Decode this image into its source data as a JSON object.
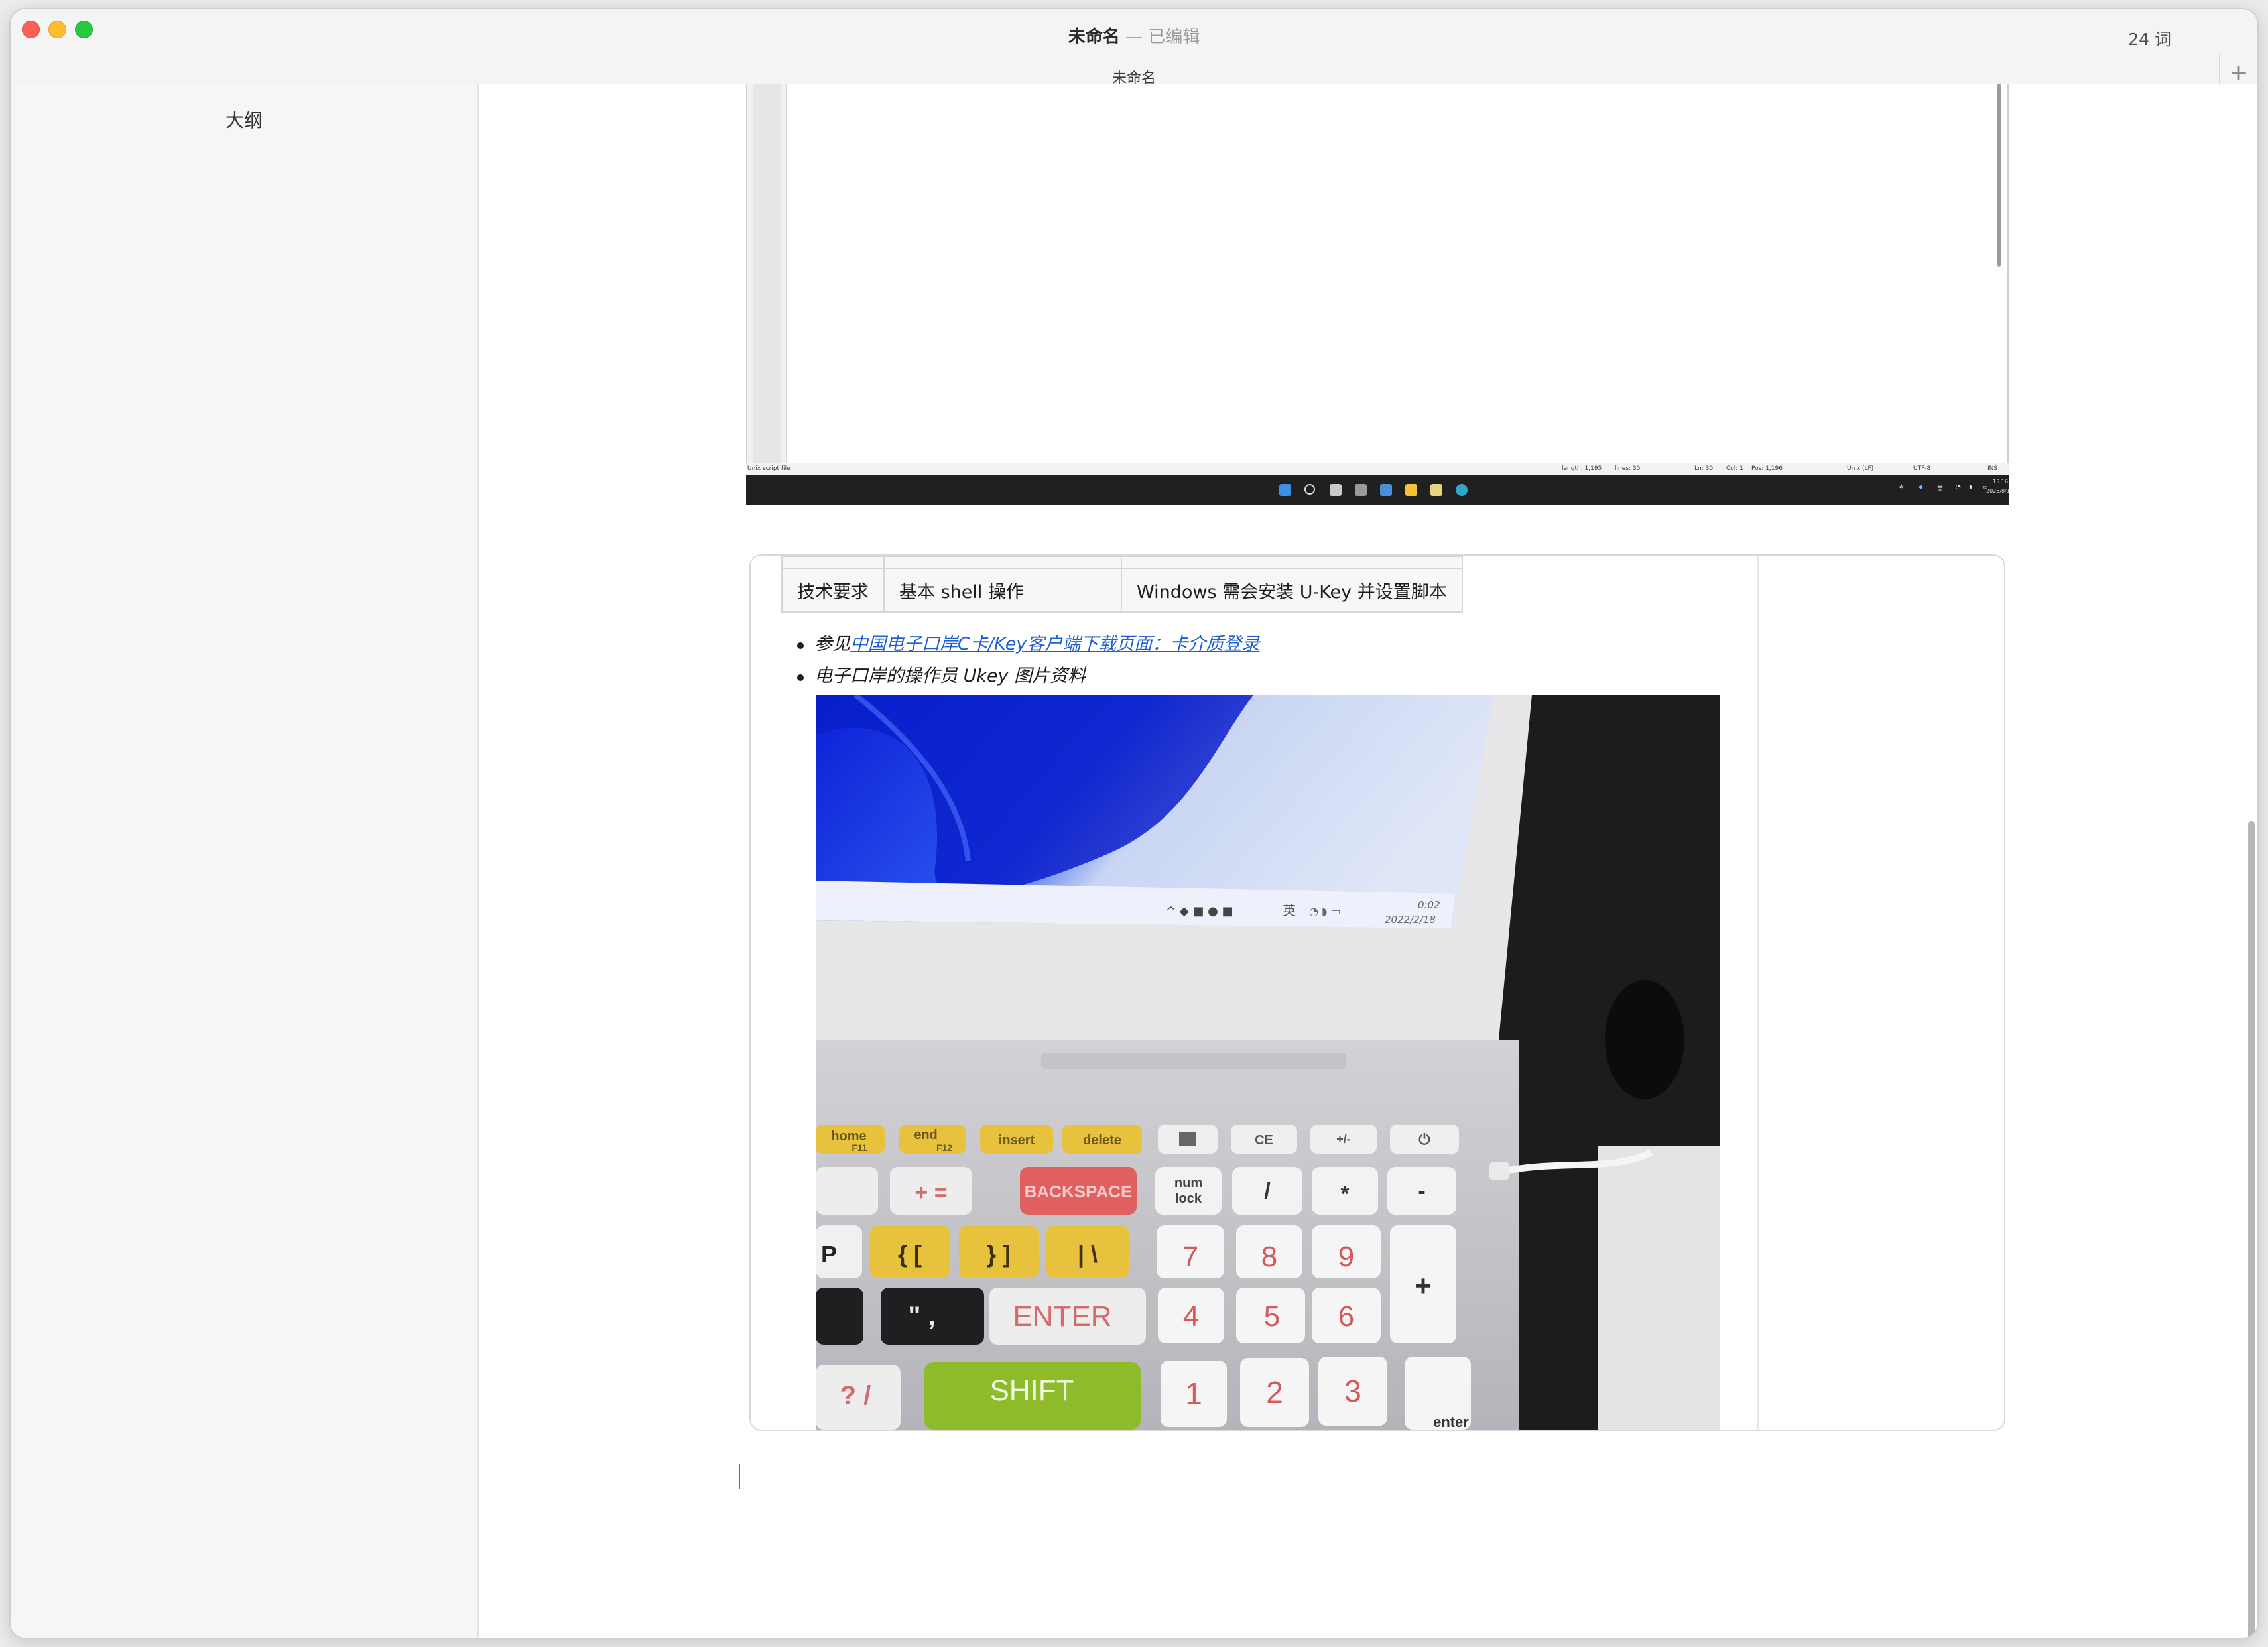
{
  "window": {
    "doc_name": "未命名",
    "separator": "—",
    "edit_state": "已编辑",
    "word_count": "24 词",
    "tab_title": "未命名",
    "new_tab_glyph": "+"
  },
  "sidebar": {
    "outline_label": "大纲"
  },
  "screenshot": {
    "status_left": "Unix script file",
    "status_length": "length: 1,195",
    "status_lines": "lines: 30",
    "status_ln": "Ln: 30",
    "status_col": "Col: 1",
    "status_pos": "Pos: 1,196",
    "status_eol": "Unix (LF)",
    "status_encoding": "UTF-8",
    "status_mode": "INS",
    "taskbar_lang": "英",
    "taskbar_time": "15:16",
    "taskbar_date": "2025/8/1"
  },
  "table": {
    "rows": [
      {
        "col1": "技术要求",
        "col2": "基本 shell 操作",
        "col3": "Windows 需会安装 U-Key 并设置脚本"
      }
    ]
  },
  "notes": {
    "item1_prefix": "参见",
    "item1_link": "中国电子口岸C卡/Key客户端下载页面：卡介质登录",
    "item2": "电子口岸的操作员 Ukey 图片资料"
  },
  "photo": {
    "screen_date": "2022/2/18",
    "screen_time": "0:02",
    "screen_lang": "英",
    "keys": {
      "home": "home",
      "f11": "F11",
      "end": "end",
      "f12": "F12",
      "insert": "insert",
      "delete": "delete",
      "ce": "CE",
      "plusminus": "+/-",
      "backspace": "BACKSPACE",
      "numlock_1": "num",
      "numlock_2": "lock",
      "slash": "/",
      "star": "*",
      "minus": "-",
      "seven": "7",
      "eight": "8",
      "nine": "9",
      "plus": "+",
      "enter": "ENTER",
      "four": "4",
      "five": "5",
      "six": "6",
      "shift": "SHIFT",
      "one": "1",
      "two": "2",
      "three": "3",
      "enter_small": "enter"
    }
  },
  "colors": {
    "link": "#1f5fd6",
    "close": "#fe5f57",
    "minimize": "#febc2e",
    "maximize": "#28c840"
  }
}
